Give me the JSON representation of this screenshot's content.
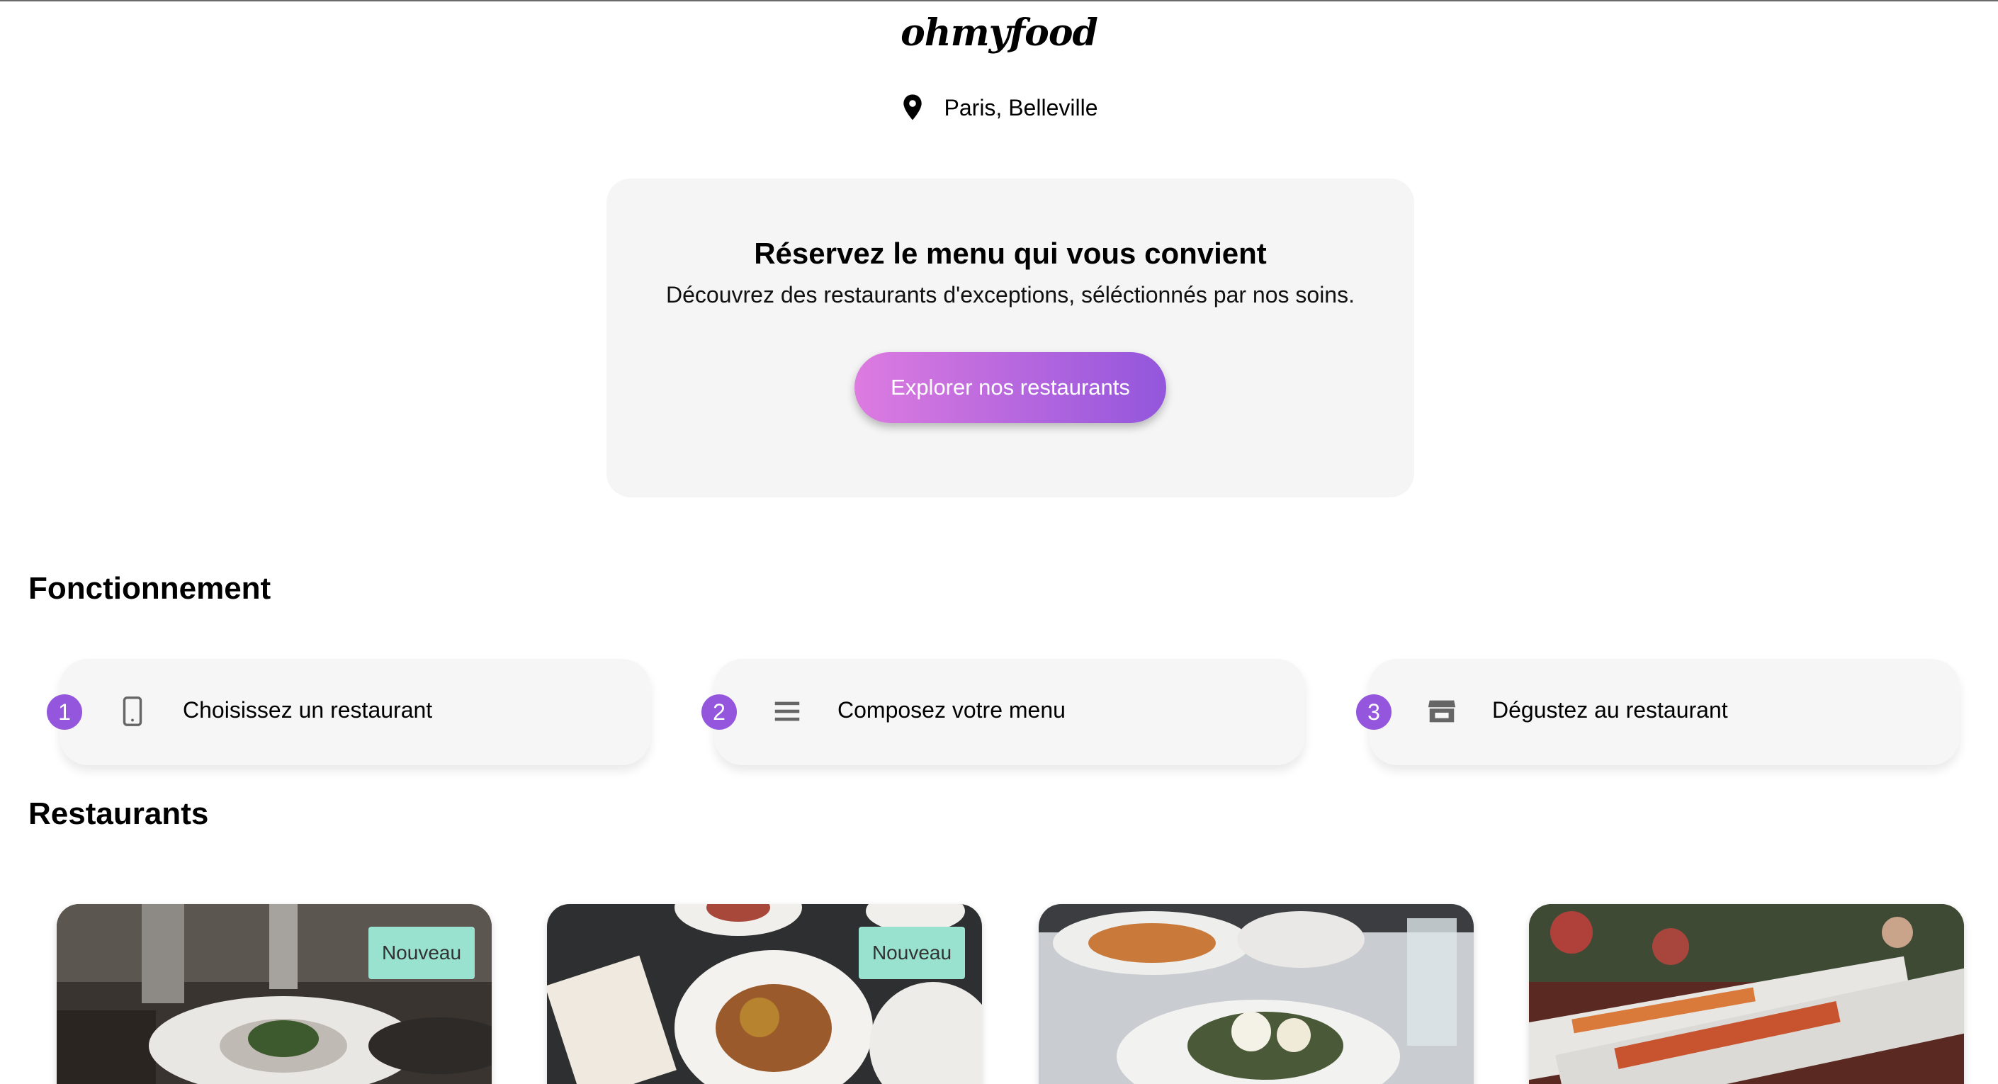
{
  "header": {
    "logo": "ohmyfood",
    "location": "Paris, Belleville",
    "location_icon": "location-pin-icon"
  },
  "hero": {
    "title": "Réservez le menu qui vous convient",
    "subtitle": "Découvrez des restaurants d'exceptions, séléctionnés par nos soins.",
    "cta_label": "Explorer nos restaurants",
    "cta_gradient": [
      "#dd7be0",
      "#9356dc"
    ]
  },
  "how_it_works": {
    "title": "Fonctionnement",
    "accent": "#9356dc",
    "steps": [
      {
        "number": "1",
        "icon": "smartphone-icon",
        "label": "Choisissez un restaurant"
      },
      {
        "number": "2",
        "icon": "menu-lines-icon",
        "label": "Composez votre menu"
      },
      {
        "number": "3",
        "icon": "storefront-icon",
        "label": "Dégustez au restaurant"
      }
    ]
  },
  "restaurants": {
    "title": "Restaurants",
    "badge_color": "#99e2d0",
    "cards": [
      {
        "badge": "Nouveau"
      },
      {
        "badge": "Nouveau"
      },
      {
        "badge": ""
      },
      {
        "badge": ""
      }
    ]
  }
}
